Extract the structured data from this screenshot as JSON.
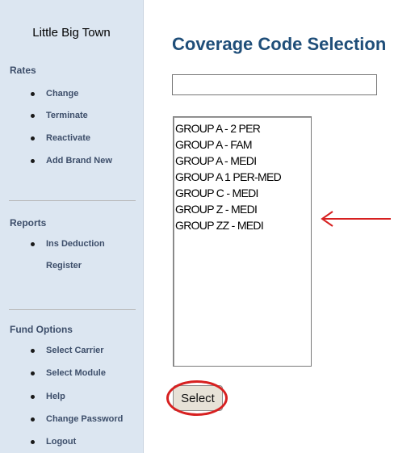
{
  "sidebar": {
    "title": "Little Big Town",
    "sections": [
      {
        "heading": "Rates",
        "items": [
          "Change",
          "Terminate",
          "Reactivate",
          "Add Brand New"
        ]
      },
      {
        "heading": "Reports",
        "items": [
          "Ins Deduction",
          "Register"
        ]
      },
      {
        "heading": "Fund Options",
        "items": [
          "Select Carrier",
          "Select Module",
          "Help",
          "Change Password",
          "Logout"
        ]
      }
    ]
  },
  "main": {
    "title": "Coverage Code Selection",
    "input_value": "",
    "codes": [
      "GROUP A - 2 PER",
      "GROUP A - FAM",
      "GROUP A - MEDI",
      "GROUP A 1 PER-MED",
      "GROUP C - MEDI",
      "GROUP Z - MEDI",
      "GROUP ZZ - MEDI"
    ],
    "select_label": "Select"
  },
  "annotation_color": "#d72020",
  "icons": {
    "annotation": "arrow-left-icon"
  }
}
